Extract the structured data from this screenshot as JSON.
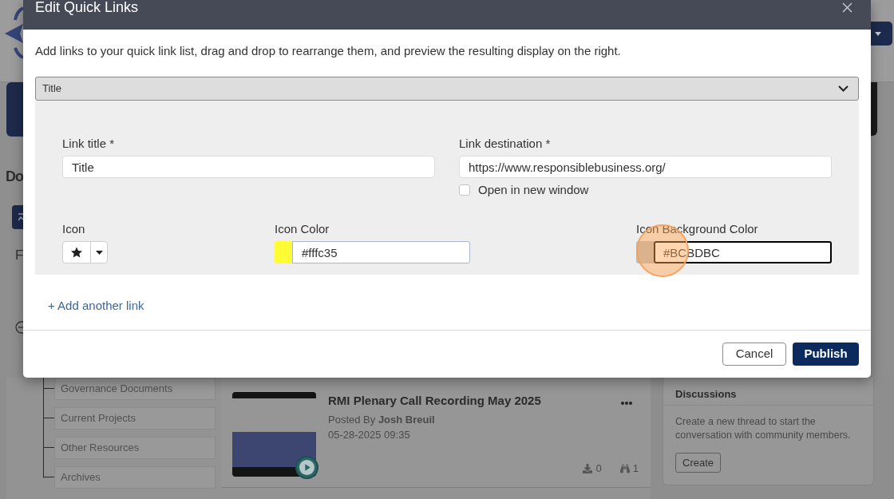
{
  "page": {
    "left_heading": "Do",
    "left_label": "F",
    "folders": [
      {
        "label": "Governance Documents"
      },
      {
        "label": "Current Projects"
      },
      {
        "label": "Other Resources"
      },
      {
        "label": "Archives"
      }
    ],
    "post": {
      "title": "RMI Plenary Call Recording May 2025",
      "byline": "Posted By **Josh Breuil**",
      "date": "05-28-2025 09:35",
      "downloads": "0",
      "views": "1"
    },
    "discussions": {
      "title": "Discussions",
      "text": "Create a new thread to start the conversation with community members.",
      "button": "Create"
    }
  },
  "dialog": {
    "title": "Edit Quick Links",
    "description": "Add links to your quick link list, drag and drop to rearrange them, and preview the resulting display on the right.",
    "links": [
      {
        "header": "Title",
        "expanded": true,
        "title_field": {
          "label": "Link title *",
          "value": "Title"
        },
        "destination_field": {
          "label": "Link destination *",
          "value": "https://www.responsiblebusiness.org/"
        },
        "new_window": {
          "label": "Open in new window",
          "checked": false
        },
        "icon_field": {
          "label": "Icon"
        },
        "icon_color": {
          "label": "Icon Color",
          "value": "#fffc35",
          "color": "#fffc35",
          "focused": false
        },
        "background_color": {
          "label": "Icon Background Color",
          "value": "#BCBDBC",
          "color": "#bcbdbc",
          "focused": true
        }
      }
    ],
    "add_link": "+ Add another link",
    "buttons": [
      {
        "label": "Cancel",
        "kind": "secondary"
      },
      {
        "label": "Publish",
        "kind": "primary"
      }
    ]
  }
}
